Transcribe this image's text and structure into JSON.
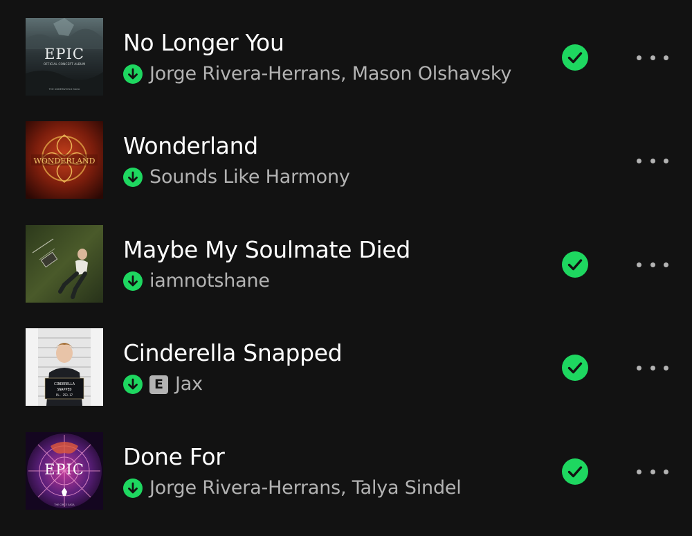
{
  "colors": {
    "background": "#121212",
    "accent": "#1ed760",
    "primary_text": "#ffffff",
    "secondary_text": "#b3b3b3"
  },
  "tracks": [
    {
      "title": "No Longer You",
      "artists": "Jorge Rivera-Herrans, Mason Olshavsky",
      "downloaded": true,
      "explicit": false,
      "saved": true,
      "art_text": "EPIC",
      "art_subtitle": "OFFICIAL CONCEPT ALBUM",
      "art_footer": "THE UNDERWORLD SAGA"
    },
    {
      "title": "Wonderland",
      "artists": "Sounds Like Harmony",
      "downloaded": true,
      "explicit": false,
      "saved": false,
      "art_text": "WONDERLAND",
      "art_subtitle": "",
      "art_footer": ""
    },
    {
      "title": "Maybe My Soulmate Died",
      "artists": "iamnotshane",
      "downloaded": true,
      "explicit": false,
      "saved": true,
      "art_text": "",
      "art_subtitle": "",
      "art_footer": ""
    },
    {
      "title": "Cinderella Snapped",
      "artists": "Jax",
      "downloaded": true,
      "explicit": true,
      "explicit_label": "E",
      "saved": true,
      "art_text": "CINDERELLA",
      "art_subtitle": "SNAPPED",
      "art_footer": "PL. 253.17"
    },
    {
      "title": "Done For",
      "artists": "Jorge Rivera-Herrans, Talya Sindel",
      "downloaded": true,
      "explicit": false,
      "saved": true,
      "art_text": "EPIC",
      "art_subtitle": "",
      "art_footer": "THE CIRCE SAGA"
    }
  ],
  "icons": {
    "download": "download-arrow-circle",
    "saved": "check-circle",
    "more": "more-dots-horizontal"
  }
}
